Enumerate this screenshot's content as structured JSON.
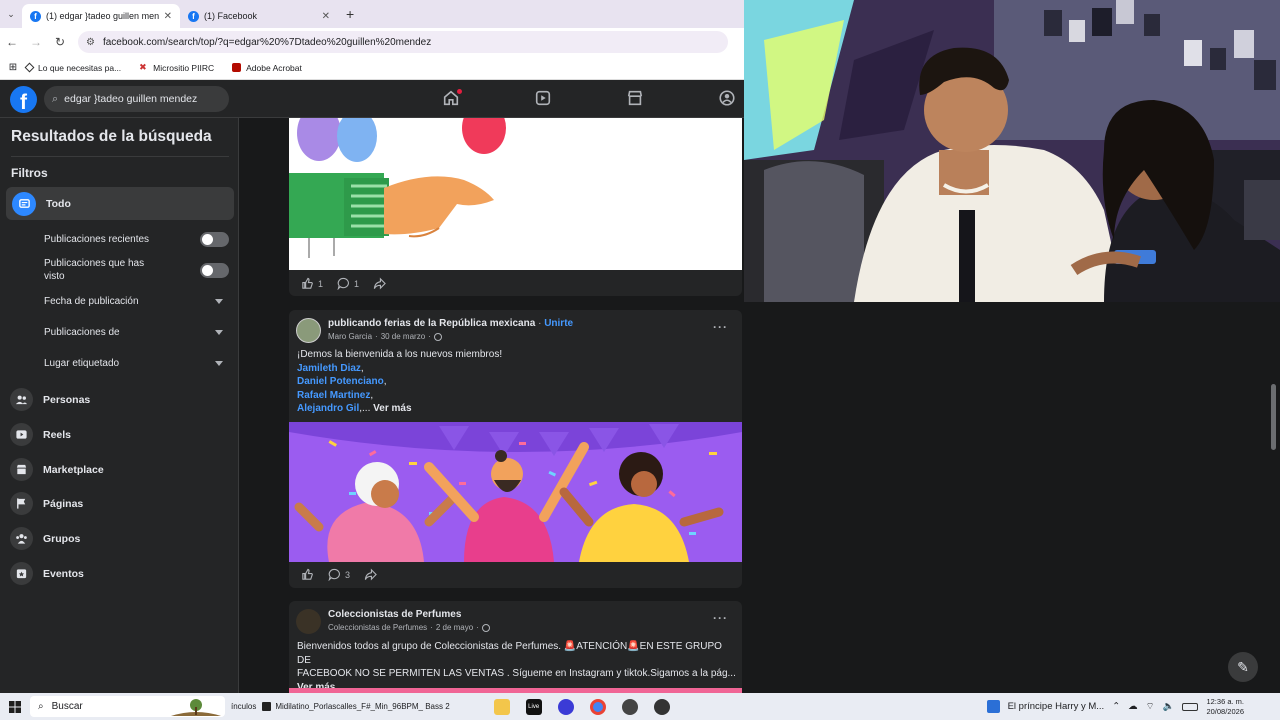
{
  "browser": {
    "tabs": [
      {
        "label": "(1) edgar }tadeo guillen mendez",
        "active": true
      },
      {
        "label": "(1) Facebook",
        "active": false
      }
    ],
    "url": "facebook.com/search/top/?q=edgar%20%7Dtadeo%20guillen%20mendez",
    "bookmarks": [
      {
        "label": "Lo que necesitas pa...",
        "icon": "diamond-icon"
      },
      {
        "label": "Micrositio PIIRC",
        "icon": "tool-icon"
      },
      {
        "label": "Adobe Acrobat",
        "icon": "acrobat-icon"
      }
    ]
  },
  "fb": {
    "search_value": "edgar }tadeo guillen mendez",
    "colors": {
      "brand": "#1877f2",
      "link": "#4599ff",
      "surface": "#242526",
      "background": "#18191a"
    }
  },
  "sidebar": {
    "title": "Resultados de la búsqueda",
    "filters_label": "Filtros",
    "todo_label": "Todo",
    "subfilters": [
      {
        "label": "Publicaciones recientes",
        "control": "toggle"
      },
      {
        "label": "Publicaciones que has visto",
        "control": "toggle"
      },
      {
        "label": "Fecha de publicación",
        "control": "dropdown"
      },
      {
        "label": "Publicaciones de",
        "control": "dropdown"
      },
      {
        "label": "Lugar etiquetado",
        "control": "dropdown"
      }
    ],
    "categories": [
      {
        "label": "Personas",
        "icon": "people-icon"
      },
      {
        "label": "Reels",
        "icon": "reels-icon"
      },
      {
        "label": "Marketplace",
        "icon": "marketplace-icon"
      },
      {
        "label": "Páginas",
        "icon": "flag-icon"
      },
      {
        "label": "Grupos",
        "icon": "groups-icon"
      },
      {
        "label": "Eventos",
        "icon": "calendar-icon"
      }
    ]
  },
  "posts": [
    {
      "likes": "1",
      "comments": "1"
    },
    {
      "group": "publicando ferias de la República mexicana",
      "join": "Unirte",
      "author": "Maro Garcia",
      "date": "30 de marzo",
      "text": "¡Demos la bienvenida a los nuevos miembros!",
      "members": [
        "Jamileth Diaz",
        "Daniel Potenciano",
        "Rafael Martinez",
        "Alejandro Gil"
      ],
      "more": "Ver más",
      "likes": "",
      "comments": "3"
    },
    {
      "group": "Coleccionistas de Perfumes",
      "author": "Coleccionistas de Perfumes",
      "date": "2 de mayo",
      "text_line1": "Bienvenidos todos al grupo de Coleccionistas de Perfumes. 🚨ATENCIÓN🚨EN ESTE GRUPO DE",
      "text_line2": "FACEBOOK NO SE PERMITEN LAS VENTAS . Sígueme en Instagram y tiktok.Sigamos a la pág...",
      "more": "Ver más"
    }
  ],
  "taskbar": {
    "search_label": "Buscar",
    "app_partial": "ínculos",
    "app_file": "Midilatino_Porlascalles_F#_Min_96BPM_ Bass 2",
    "live_label": "Live",
    "news": "El príncipe Harry y M...",
    "time": "12:36 a. m.",
    "date": "20/08/2026"
  }
}
